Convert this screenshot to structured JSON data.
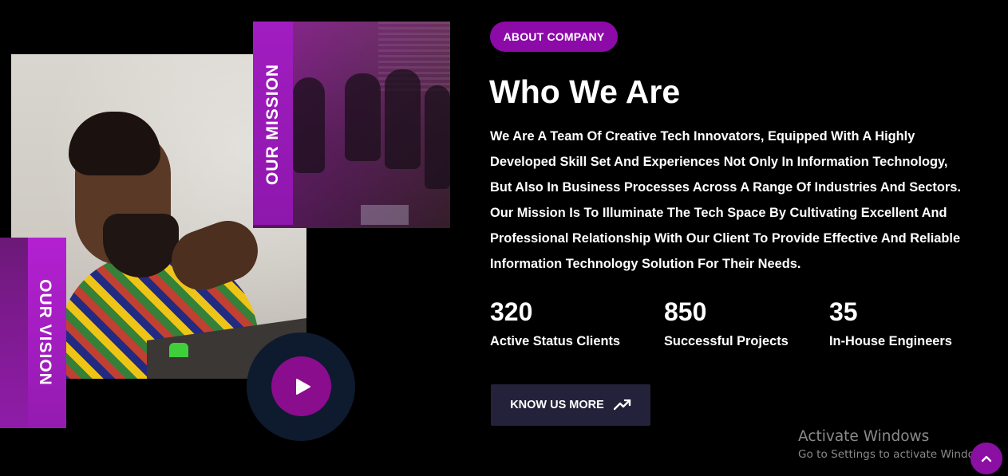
{
  "collage": {
    "mission_label": "OUR MISSION",
    "vision_label": "OUR VISION",
    "play_icon": "play-icon"
  },
  "about": {
    "badge": "ABOUT COMPANY",
    "title": "Who We Are",
    "description": "We Are A Team Of Creative Tech Innovators, Equipped With A Highly Developed Skill Set And Experiences Not Only In Information Technology, But Also In Business Processes Across A Range Of Industries And Sectors. Our Mission Is To Illuminate The Tech Space By Cultivating Excellent And Professional Relationship With Our Client To Provide Effective And Reliable Information Technology Solution For Their Needs."
  },
  "stats": [
    {
      "value": "320",
      "label": "Active Status Clients"
    },
    {
      "value": "850",
      "label": "Successful Projects"
    },
    {
      "value": "35",
      "label": "In-House Engineers"
    }
  ],
  "cta": {
    "label": "KNOW US MORE",
    "icon": "trending-up-icon"
  },
  "watermark": {
    "title": "Activate Windows",
    "subtitle": "Go to Settings to activate Windows."
  },
  "scroll_top": {
    "icon": "chevron-up-icon"
  },
  "colors": {
    "background": "#000000",
    "accent_purple": "#8c0aa8",
    "button_dark": "#24223a",
    "play_ring": "#0e1a2e",
    "text": "#ffffff",
    "watermark": "#8a8a8a"
  }
}
